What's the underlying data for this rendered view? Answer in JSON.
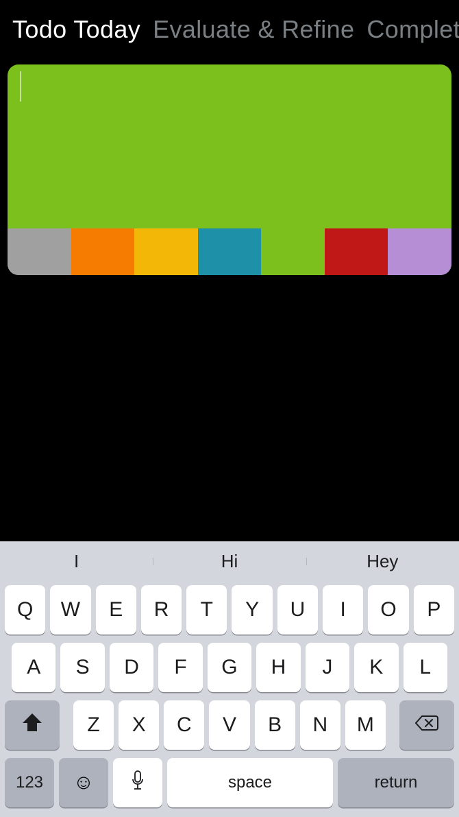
{
  "tabs": [
    {
      "label": "Todo Today",
      "active": true
    },
    {
      "label": "Evaluate & Refine",
      "active": false
    },
    {
      "label": "Completed",
      "active": false
    }
  ],
  "card": {
    "background": "#7cc01e",
    "swatches": [
      "#a0a0a0",
      "#f57c00",
      "#f2b707",
      "#1e90a8",
      "#7cc01e",
      "#c01717",
      "#b58ed6"
    ]
  },
  "keyboard": {
    "suggestions": [
      "I",
      "Hi",
      "Hey"
    ],
    "row1": [
      "Q",
      "W",
      "E",
      "R",
      "T",
      "Y",
      "U",
      "I",
      "O",
      "P"
    ],
    "row2": [
      "A",
      "S",
      "D",
      "F",
      "G",
      "H",
      "J",
      "K",
      "L"
    ],
    "row3": [
      "Z",
      "X",
      "C",
      "V",
      "B",
      "N",
      "M"
    ],
    "numkey": "123",
    "space": "space",
    "return": "return"
  }
}
